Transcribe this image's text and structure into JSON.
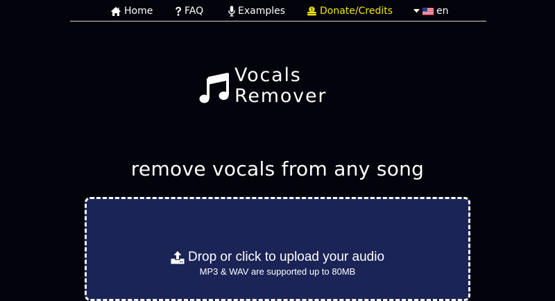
{
  "nav": {
    "home": {
      "label": "Home",
      "icon": "home-icon"
    },
    "faq": {
      "label": "FAQ",
      "icon": "question-icon"
    },
    "examples": {
      "label": "Examples",
      "icon": "microphone-icon"
    },
    "donate": {
      "label": "Donate/Credits",
      "icon": "coins-icon",
      "color": "#f2e600"
    },
    "language": {
      "label": "en",
      "icon": "us-flag-icon"
    }
  },
  "logo": {
    "line1": "Vocals",
    "line2": "Remover",
    "icon": "music-note-icon"
  },
  "tagline": "remove vocals from any song",
  "upload": {
    "main": "Drop or click to upload your audio",
    "sub": "MP3 & WAV are supported up to 80MB",
    "icon": "upload-icon",
    "background": "#1b2456"
  },
  "colors": {
    "page_background": "#03030b",
    "text": "#ffffff"
  }
}
